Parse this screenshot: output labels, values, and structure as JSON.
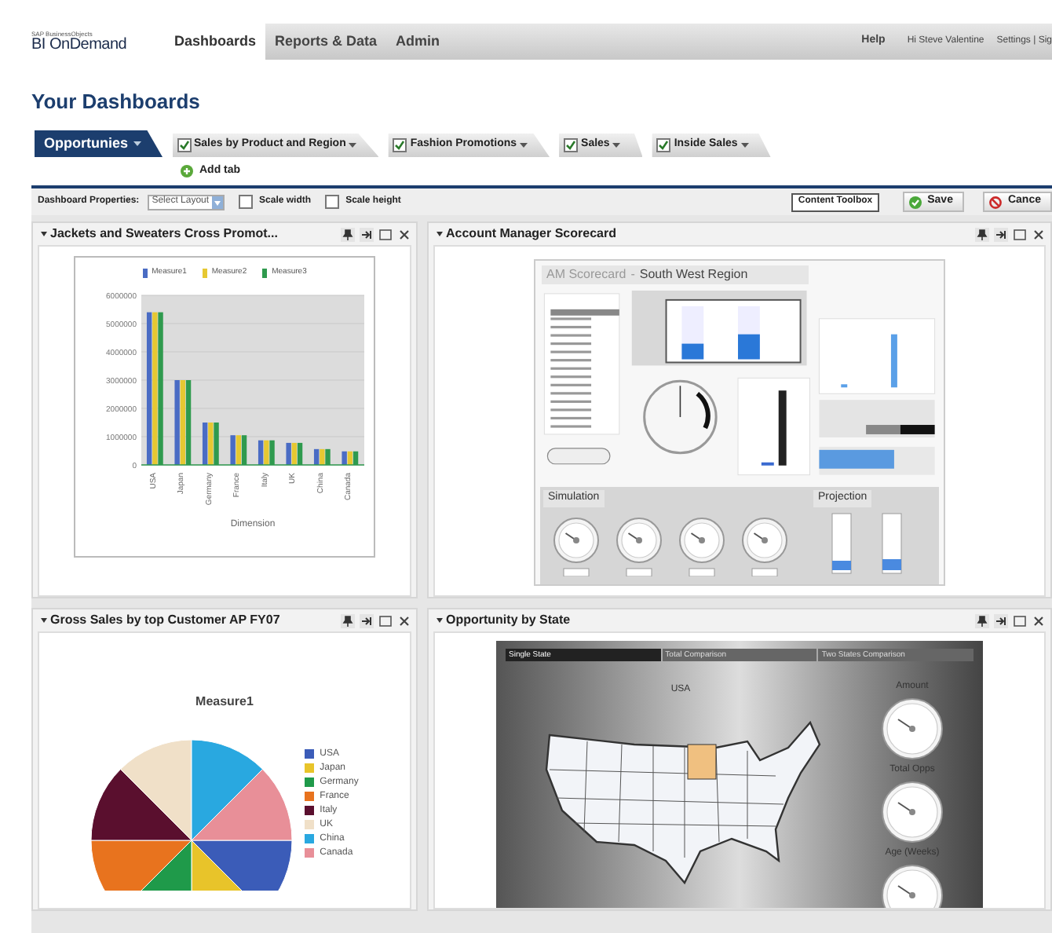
{
  "header": {
    "logo_small": "SAP BusinessObjects",
    "logo": "BI OnDemand",
    "nav": [
      {
        "label": "Dashboards",
        "selected": true
      },
      {
        "label": "Reports & Data",
        "selected": false
      },
      {
        "label": "Admin",
        "selected": false
      }
    ],
    "help": "Help",
    "greeting": "Hi Steve Valentine",
    "settings": "Settings | Sig"
  },
  "page_title": "Your Dashboards",
  "tabs": [
    {
      "label": "Opportunies",
      "selected": true,
      "checked": false
    },
    {
      "label": "Sales by Product and Region",
      "selected": false,
      "checked": true
    },
    {
      "label": "Fashion Promotions",
      "selected": false,
      "checked": true
    },
    {
      "label": "Sales",
      "selected": false,
      "checked": true
    },
    {
      "label": "Inside Sales",
      "selected": false,
      "checked": true
    }
  ],
  "add_tab": "Add tab",
  "toolbar": {
    "properties_label": "Dashboard Properties:",
    "layout_select": "Select Layout",
    "options": [
      {
        "label": "Scale width",
        "checked": false
      },
      {
        "label": "Scale height",
        "checked": false
      }
    ],
    "buttons": [
      {
        "kind": "plain",
        "label": "Content Toolbox"
      },
      {
        "kind": "save",
        "label": "Save"
      },
      {
        "kind": "cancel",
        "label": "Cance"
      }
    ]
  },
  "panels": [
    {
      "kind": "bar_chart",
      "title": "Jackets and Sweaters Cross Promot...",
      "chart_data": {
        "type": "bar",
        "xlabel": "Dimension",
        "categories": [
          "USA",
          "Japan",
          "Germany",
          "France",
          "Italy",
          "UK",
          "China",
          "Canada"
        ],
        "series": [
          {
            "name": "Measure1",
            "color": "#4a6cc4",
            "values": [
              5400000,
              3000000,
              1500000,
              1050000,
              870000,
              780000,
              560000,
              480000
            ]
          },
          {
            "name": "Measure2",
            "color": "#e6c832",
            "values": [
              5400000,
              3000000,
              1500000,
              1050000,
              870000,
              780000,
              560000,
              480000
            ]
          },
          {
            "name": "Measure3",
            "color": "#2f9a4e",
            "values": [
              5400000,
              3000000,
              1500000,
              1050000,
              870000,
              780000,
              560000,
              480000
            ]
          }
        ],
        "grid": true,
        "legend": "top",
        "ylim": [
          0,
          6000000
        ],
        "yticks": [
          0,
          1000000,
          2000000,
          3000000,
          4000000,
          5000000,
          6000000
        ]
      }
    },
    {
      "kind": "scorecard",
      "title": "Account Manager Scorecard",
      "scorecard": {
        "title": "AM Scorecard",
        "separator": "-",
        "region": "South West Region",
        "simulation": "Simulation",
        "projection": "Projection"
      }
    },
    {
      "kind": "pie",
      "title": "Gross Sales by top Customer AP FY07",
      "pie": {
        "title": "Measure1",
        "legend": [
          {
            "label": "USA",
            "color": "#3b5cb8"
          },
          {
            "label": "Japan",
            "color": "#e8c42a"
          },
          {
            "label": "Germany",
            "color": "#1f9a4a"
          },
          {
            "label": "France",
            "color": "#e8731e"
          },
          {
            "label": "Italy",
            "color": "#5a0f2e"
          },
          {
            "label": "UK",
            "color": "#f0e0c8"
          },
          {
            "label": "China",
            "color": "#29a8e0"
          },
          {
            "label": "Canada",
            "color": "#e88f98"
          }
        ]
      }
    },
    {
      "kind": "map",
      "title": "Opportunity by State",
      "map": {
        "tabs": [
          {
            "label": "Single State",
            "selected": true
          },
          {
            "label": "Total Comparison",
            "selected": false
          },
          {
            "label": "Two States Comparison",
            "selected": false
          }
        ],
        "country": "USA",
        "gauges": [
          "Amount",
          "Total Opps",
          "Age (Weeks)"
        ]
      }
    }
  ]
}
